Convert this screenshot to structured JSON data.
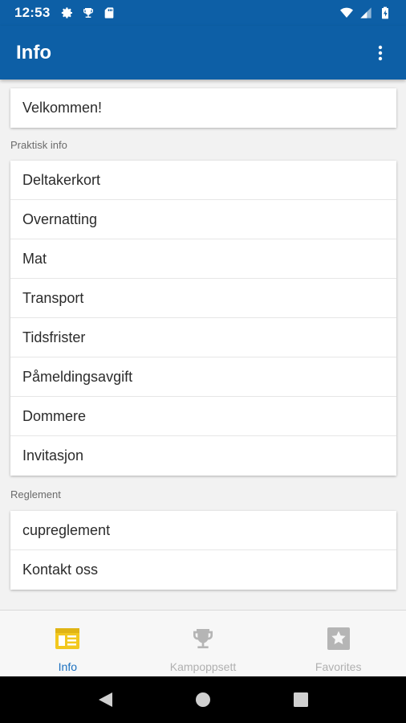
{
  "status_bar": {
    "time": "12:53",
    "left_icons": [
      "gear-icon",
      "trophy-icon",
      "sd-card-icon"
    ],
    "right_icons": [
      "wifi-icon",
      "cell-signal-icon",
      "battery-icon"
    ]
  },
  "app_bar": {
    "title": "Info",
    "menu_icon": "more-vert-icon",
    "color": "#0d5fa6"
  },
  "welcome": {
    "label": "Velkommen!"
  },
  "sections": [
    {
      "header": "Praktisk info",
      "items": [
        "Deltakerkort",
        "Overnatting",
        "Mat",
        "Transport",
        "Tidsfrister",
        "Påmeldingsavgift",
        "Dommere",
        "Invitasjon"
      ]
    },
    {
      "header": "Reglement",
      "items": [
        "cupreglement",
        "Kontakt oss"
      ]
    }
  ],
  "bottom_nav": {
    "active_color": "#f2c81e",
    "items": [
      {
        "label": "Info",
        "icon": "info-list-icon",
        "active": true
      },
      {
        "label": "Kampoppsett",
        "icon": "trophy-icon",
        "active": false
      },
      {
        "label": "Favorites",
        "icon": "star-icon",
        "active": false
      }
    ]
  },
  "system_nav": [
    "back-icon",
    "home-icon",
    "recents-icon"
  ]
}
